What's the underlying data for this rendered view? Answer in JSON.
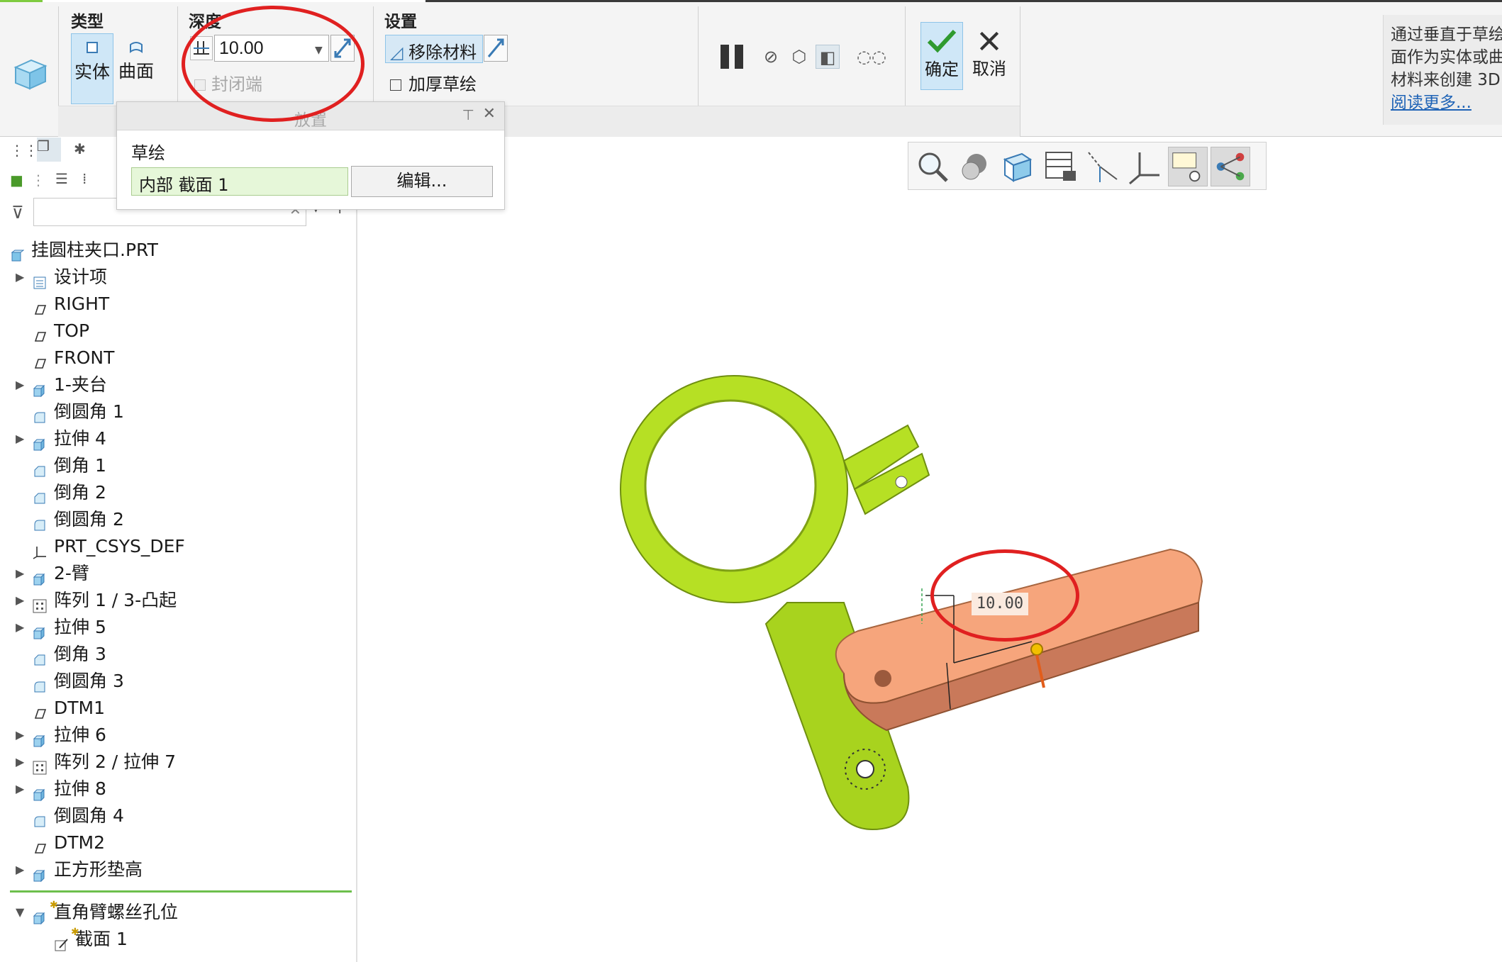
{
  "ribbon": {
    "groups": {
      "type": "类型",
      "depth": "深度",
      "settings": "设置"
    },
    "type_buttons": {
      "solid": "实体",
      "surface": "曲面"
    },
    "depth": {
      "value": "10.00",
      "cap_end": "封闭端"
    },
    "settings": {
      "remove_material": "移除材料",
      "thicken_sketch": "加厚草绘"
    },
    "actions": {
      "ok": "确定",
      "cancel": "取消"
    },
    "help": {
      "lines": [
        "通过垂直于草绘",
        "面作为实体或曲",
        "材料来创建 3D"
      ],
      "link": "阅读更多..."
    }
  },
  "placement_panel": {
    "title": "放置",
    "sketch_label": "草绘",
    "sketch_value": "内部 截面 1",
    "edit_button": "编辑..."
  },
  "model_tree": {
    "items": [
      {
        "label": "挂圆柱夹口.PRT",
        "icon": "part-icon",
        "expand": false,
        "indent": 0
      },
      {
        "label": "设计项",
        "icon": "design-items-icon",
        "expand": true,
        "indent": 1
      },
      {
        "label": "RIGHT",
        "icon": "datum-plane-icon",
        "expand": false,
        "indent": 1
      },
      {
        "label": "TOP",
        "icon": "datum-plane-icon",
        "expand": false,
        "indent": 1
      },
      {
        "label": "FRONT",
        "icon": "datum-plane-icon",
        "expand": false,
        "indent": 1
      },
      {
        "label": "1-夹台",
        "icon": "extrude-icon",
        "expand": true,
        "indent": 1
      },
      {
        "label": "倒圆角 1",
        "icon": "round-icon",
        "expand": false,
        "indent": 1
      },
      {
        "label": "拉伸 4",
        "icon": "extrude-icon",
        "expand": true,
        "indent": 1
      },
      {
        "label": "倒角 1",
        "icon": "chamfer-icon",
        "expand": false,
        "indent": 1
      },
      {
        "label": "倒角 2",
        "icon": "chamfer-icon",
        "expand": false,
        "indent": 1
      },
      {
        "label": "倒圆角 2",
        "icon": "round-icon",
        "expand": false,
        "indent": 1
      },
      {
        "label": "PRT_CSYS_DEF",
        "icon": "csys-icon",
        "expand": false,
        "indent": 1
      },
      {
        "label": "2-臂",
        "icon": "extrude-icon",
        "expand": true,
        "indent": 1
      },
      {
        "label": "阵列 1 / 3-凸起",
        "icon": "pattern-icon",
        "expand": true,
        "indent": 1
      },
      {
        "label": "拉伸 5",
        "icon": "extrude-icon",
        "expand": true,
        "indent": 1
      },
      {
        "label": "倒角 3",
        "icon": "chamfer-icon",
        "expand": false,
        "indent": 1
      },
      {
        "label": "倒圆角 3",
        "icon": "round-icon",
        "expand": false,
        "indent": 1
      },
      {
        "label": "DTM1",
        "icon": "datum-plane-icon",
        "expand": false,
        "indent": 1
      },
      {
        "label": "拉伸 6",
        "icon": "extrude-icon",
        "expand": true,
        "indent": 1
      },
      {
        "label": "阵列 2 / 拉伸 7",
        "icon": "pattern-icon",
        "expand": true,
        "indent": 1
      },
      {
        "label": "拉伸 8",
        "icon": "extrude-icon",
        "expand": true,
        "indent": 1
      },
      {
        "label": "倒圆角 4",
        "icon": "round-icon",
        "expand": false,
        "indent": 1
      },
      {
        "label": "DTM2",
        "icon": "datum-plane-icon",
        "expand": false,
        "indent": 1
      },
      {
        "label": "正方形垫高",
        "icon": "extrude-icon",
        "expand": true,
        "indent": 1
      }
    ],
    "active_items": [
      {
        "label": "直角臂螺丝孔位",
        "icon": "extrude-icon",
        "expand": true,
        "expanded": true
      },
      {
        "label": "截面 1",
        "icon": "sketch-icon",
        "expand": false
      }
    ]
  },
  "viewport": {
    "dimension_value": "10.00"
  },
  "colors": {
    "accent": "#8ec4e8",
    "part_green": "#b6e024",
    "part_orange": "#f6a57c",
    "annotation_red": "#e02020"
  }
}
